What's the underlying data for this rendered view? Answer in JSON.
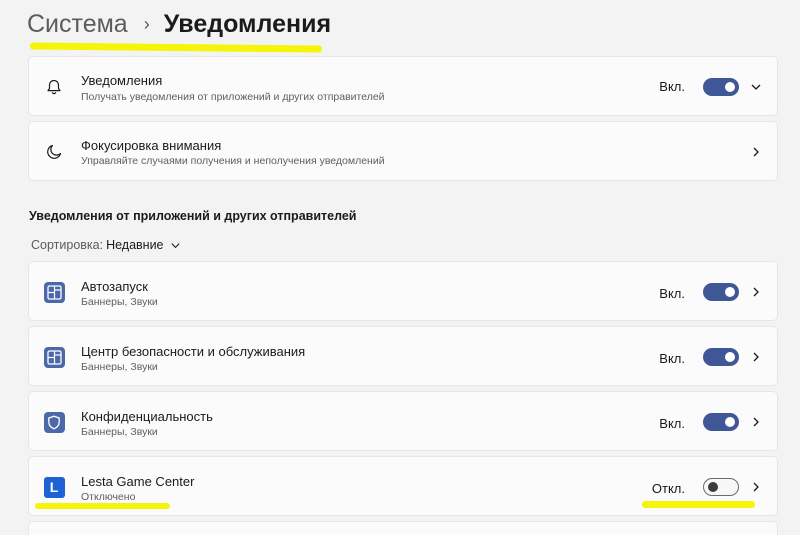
{
  "breadcrumb": {
    "parent": "Система",
    "separator": "›",
    "current": "Уведомления"
  },
  "notifications": {
    "title": "Уведомления",
    "subtitle": "Получать уведомления от приложений и других отправителей",
    "state": "Вкл.",
    "enabled": true
  },
  "focus": {
    "title": "Фокусировка внимания",
    "subtitle": "Управляйте случаями получения и неполучения уведомлений"
  },
  "section_title": "Уведомления от приложений и других отправителей",
  "sort": {
    "label": "Сортировка:",
    "value": "Недавние"
  },
  "apps": [
    {
      "name": "Автозапуск",
      "detail": "Баннеры, Звуки",
      "state": "Вкл.",
      "enabled": true,
      "icon": "autostart-icon"
    },
    {
      "name": "Центр безопасности и обслуживания",
      "detail": "Баннеры, Звуки",
      "state": "Вкл.",
      "enabled": true,
      "icon": "security-center-icon"
    },
    {
      "name": "Конфиденциальность",
      "detail": "Баннеры, Звуки",
      "state": "Вкл.",
      "enabled": true,
      "icon": "shield-icon"
    },
    {
      "name": "Lesta Game Center",
      "detail": "Отключено",
      "state": "Откл.",
      "enabled": false,
      "icon": "lesta-logo-icon",
      "logo_letter": "L"
    }
  ],
  "colors": {
    "toggle_on": "#3f5796",
    "highlight": "#f5f50a",
    "lesta_blue": "#1e63d6"
  }
}
